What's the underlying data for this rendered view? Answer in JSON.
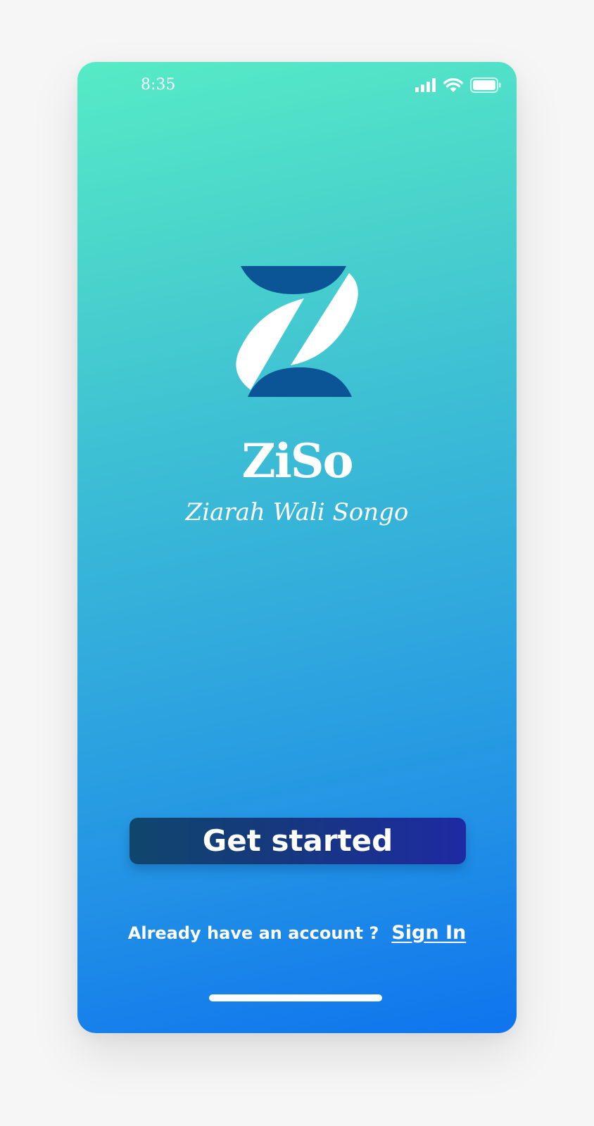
{
  "status_bar": {
    "time": "8:35",
    "icons": [
      "cellular-signal-icon",
      "wifi-icon",
      "battery-icon"
    ]
  },
  "app": {
    "logo_icon": "ziso-logo-icon",
    "name": "ZiSo",
    "tagline": "Ziarah Wali Songo"
  },
  "actions": {
    "get_started_label": "Get started",
    "signin_prompt": "Already have an account ?",
    "signin_label": "Sign In"
  },
  "colors": {
    "gradient_top": "#56ebc6",
    "gradient_bottom": "#0f74ee",
    "button_start": "#10466c",
    "button_end": "#1e2aa2",
    "logo_dark": "#0b5596",
    "text": "#ffffff"
  }
}
